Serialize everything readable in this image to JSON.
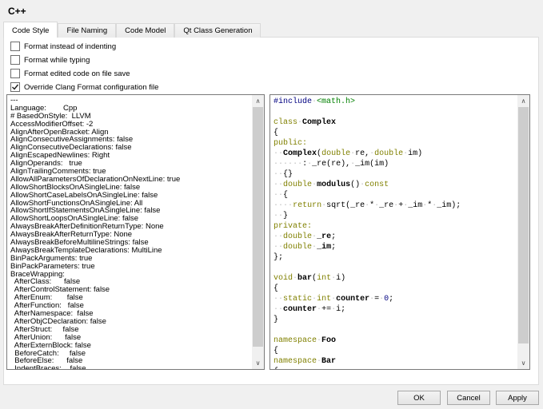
{
  "title": "C++",
  "tabs": [
    {
      "label": "Code Style",
      "active": true
    },
    {
      "label": "File Naming",
      "active": false
    },
    {
      "label": "Code Model",
      "active": false
    },
    {
      "label": "Qt Class Generation",
      "active": false
    }
  ],
  "checkboxes": [
    {
      "label": "Format instead of indenting",
      "checked": false
    },
    {
      "label": "Format while typing",
      "checked": false
    },
    {
      "label": "Format edited code on file save",
      "checked": false
    },
    {
      "label": "Override Clang Format configuration file",
      "checked": true
    }
  ],
  "config_editor": {
    "lines": [
      "---",
      "Language:        Cpp",
      "# BasedOnStyle:  LLVM",
      "AccessModifierOffset: -2",
      "AlignAfterOpenBracket: Align",
      "AlignConsecutiveAssignments: false",
      "AlignConsecutiveDeclarations: false",
      "AlignEscapedNewlines: Right",
      "AlignOperands:   true",
      "AlignTrailingComments: true",
      "AllowAllParametersOfDeclarationOnNextLine: true",
      "AllowShortBlocksOnASingleLine: false",
      "AllowShortCaseLabelsOnASingleLine: false",
      "AllowShortFunctionsOnASingleLine: All",
      "AllowShortIfStatementsOnASingleLine: false",
      "AllowShortLoopsOnASingleLine: false",
      "AlwaysBreakAfterDefinitionReturnType: None",
      "AlwaysBreakAfterReturnType: None",
      "AlwaysBreakBeforeMultilineStrings: false",
      "AlwaysBreakTemplateDeclarations: MultiLine",
      "BinPackArguments: true",
      "BinPackParameters: true",
      "BraceWrapping:",
      "  AfterClass:      false",
      "  AfterControlStatement: false",
      "  AfterEnum:       false",
      "  AfterFunction:   false",
      "  AfterNamespace:  false",
      "  AfterObjCDeclaration: false",
      "  AfterStruct:     false",
      "  AfterUnion:      false",
      "  AfterExternBlock: false",
      "  BeforeCatch:     false",
      "  BeforeElse:      false",
      "  IndentBraces:    false"
    ]
  },
  "preview_editor": {
    "lines": [
      [
        [
          "pp",
          "#include"
        ],
        [
          "plain",
          " "
        ],
        [
          "inc",
          "<math.h>"
        ]
      ],
      [],
      [
        [
          "kw",
          "class"
        ],
        [
          "plain",
          " "
        ],
        [
          "name",
          "Complex"
        ]
      ],
      [
        [
          "plain",
          "{"
        ]
      ],
      [
        [
          "kw",
          "public:"
        ]
      ],
      [
        [
          "plain",
          "  "
        ],
        [
          "name",
          "Complex"
        ],
        [
          "plain",
          "("
        ],
        [
          "kw",
          "double"
        ],
        [
          "plain",
          " re, "
        ],
        [
          "kw",
          "double"
        ],
        [
          "plain",
          " im)"
        ]
      ],
      [
        [
          "plain",
          "      : _re(re), _im(im)"
        ]
      ],
      [
        [
          "plain",
          "  {}"
        ]
      ],
      [
        [
          "plain",
          "  "
        ],
        [
          "kw",
          "double"
        ],
        [
          "plain",
          " "
        ],
        [
          "name",
          "modulus"
        ],
        [
          "plain",
          "() "
        ],
        [
          "kw",
          "const"
        ]
      ],
      [
        [
          "plain",
          "  {"
        ]
      ],
      [
        [
          "plain",
          "    "
        ],
        [
          "kw",
          "return"
        ],
        [
          "plain",
          " sqrt(_re * _re + _im * _im);"
        ]
      ],
      [
        [
          "plain",
          "  }"
        ]
      ],
      [
        [
          "kw",
          "private:"
        ]
      ],
      [
        [
          "plain",
          "  "
        ],
        [
          "kw",
          "double"
        ],
        [
          "plain",
          " "
        ],
        [
          "name",
          "_re"
        ],
        [
          "plain",
          ";"
        ]
      ],
      [
        [
          "plain",
          "  "
        ],
        [
          "kw",
          "double"
        ],
        [
          "plain",
          " "
        ],
        [
          "name",
          "_im"
        ],
        [
          "plain",
          ";"
        ]
      ],
      [
        [
          "plain",
          "};"
        ]
      ],
      [],
      [
        [
          "kw",
          "void"
        ],
        [
          "plain",
          " "
        ],
        [
          "name",
          "bar"
        ],
        [
          "plain",
          "("
        ],
        [
          "kw",
          "int"
        ],
        [
          "plain",
          " i)"
        ]
      ],
      [
        [
          "plain",
          "{"
        ]
      ],
      [
        [
          "plain",
          "  "
        ],
        [
          "kw",
          "static"
        ],
        [
          "plain",
          " "
        ],
        [
          "kw",
          "int"
        ],
        [
          "plain",
          " "
        ],
        [
          "name",
          "counter"
        ],
        [
          "plain",
          " = "
        ],
        [
          "num",
          "0"
        ],
        [
          "plain",
          ";"
        ]
      ],
      [
        [
          "plain",
          "  "
        ],
        [
          "name",
          "counter"
        ],
        [
          "plain",
          " += i;"
        ]
      ],
      [
        [
          "plain",
          "}"
        ]
      ],
      [],
      [
        [
          "kw",
          "namespace"
        ],
        [
          "plain",
          " "
        ],
        [
          "name",
          "Foo"
        ]
      ],
      [
        [
          "plain",
          "{"
        ]
      ],
      [
        [
          "kw",
          "namespace"
        ],
        [
          "plain",
          " "
        ],
        [
          "name",
          "Bar"
        ]
      ],
      [
        [
          "plain",
          "{"
        ]
      ]
    ]
  },
  "scrollbar": {
    "up_glyph": "∧",
    "down_glyph": "∨"
  },
  "buttons": {
    "ok": "OK",
    "cancel": "Cancel",
    "apply": "Apply"
  },
  "colors": {
    "keyword": "#808000",
    "preprocessor": "#000080",
    "include": "#008000",
    "number": "#000080",
    "whitespace-dot": "#bdbdbd"
  }
}
